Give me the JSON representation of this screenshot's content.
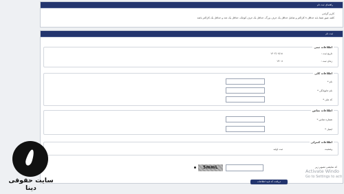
{
  "guide_panel": {
    "title": "راهنمای ثبت نام",
    "greeting": "کاربر گرامی",
    "instructions": "کلمه عبور شما باید حداقل ۸ کاراکتر و شامل حداقل یک حرف بزرگ، حداقل یک حرف کوچک، حداقل یک عدد و حداقل یک کاراکتر باشد"
  },
  "register_panel": {
    "title": "ثبت نام",
    "date_section": {
      "legend": "اطلاعات ثبتی",
      "date_label": "تاریخ ثبت :",
      "date_value": "۱۴۰۲/۰۷/۱۸",
      "time_label": "زمان ثبت :",
      "time_value": "۱۳:۰۸"
    },
    "personal_section": {
      "legend": "اطلاعات کلی",
      "first_name_label": "نام *",
      "last_name_label": "نام خانوادگی *",
      "national_code_label": "کد ملی *"
    },
    "contact_section": {
      "legend": "اطلاعات تماس",
      "phone_label": "شماره تماس *",
      "email_label": "ایمیل *"
    },
    "status_section": {
      "legend": "اطلاعات کنترلی",
      "status_label": "وضعیت",
      "status_value": "ثبت اولیه"
    },
    "captcha": {
      "label": "کد نمایشی تصویر زیر",
      "image_text": "5mmL"
    },
    "submit_label": "دریافت کد تایید اطلاعات"
  },
  "os_watermark": {
    "title": "Activate Windo",
    "subtitle": "Go to Settings to acti"
  },
  "site_logo": {
    "text": "سایت حقوقی دینا"
  }
}
